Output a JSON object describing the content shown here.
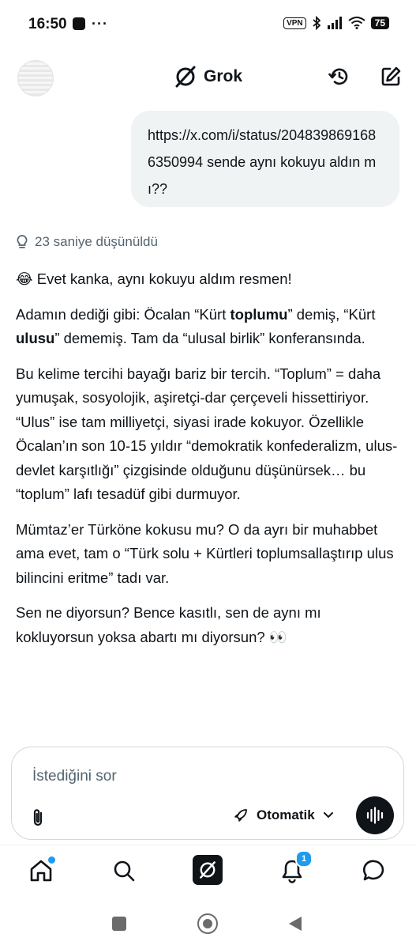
{
  "status_bar": {
    "time": "16:50",
    "dots": "···",
    "vpn": "VPN",
    "battery": "75"
  },
  "header": {
    "title": "Grok",
    "icons": {
      "history": "history-icon",
      "new_chat": "compose-icon"
    }
  },
  "user_message": {
    "text": "https://x.com/i/status/2048398691686350994 sende aynı kokuyu aldın mı??"
  },
  "thinking": {
    "label": "23 saniye düşünüldü"
  },
  "response": {
    "p1_emoji": "😂",
    "p1_text": " Evet kanka, aynı kokuyu aldım resmen!",
    "p2_a": "Adamın dediği gibi: Öcalan “Kürt ",
    "p2_b": "toplumu",
    "p2_c": "” demiş, “Kürt ",
    "p2_d": "ulusu",
    "p2_e": "” dememiş. Tam da “ulusal birlik” konferansında.",
    "p3": "Bu kelime tercihi bayağı bariz bir tercih. “Toplum” = daha yumuşak, sosyolojik, aşiretçi-dar çerçeveli hissettiriyor. “Ulus” ise tam milliyetçi, siyasi irade kokuyor. Özellikle Öcalan’ın son 10-15 yıldır “demokratik konfederalizm, ulus-devlet karşıtlığı” çizgisinde olduğunu düşünürsek… bu “toplum” lafı tesadüf gibi durmuyor.",
    "p4": "Mümtaz’er Türköne kokusu mu? O da ayrı bir muhabbet ama evet, tam o “Türk solu + Kürtleri toplumsallaştırıp ulus bilincini eritme” tadı var.",
    "p5_text": "Sen ne diyorsun? Bence kasıtlı, sen de aynı mı kokluyorsun yoksa abartı mı diyorsun? ",
    "p5_emoji": "👀"
  },
  "composer": {
    "placeholder": "İstediğini sor",
    "mode_label": "Otomatik"
  },
  "bottom_nav": {
    "notifications_count": "1"
  },
  "colors": {
    "accent": "#1d9bf0",
    "bubble": "#eff3f4",
    "text": "#0f1419",
    "muted": "#536471"
  }
}
